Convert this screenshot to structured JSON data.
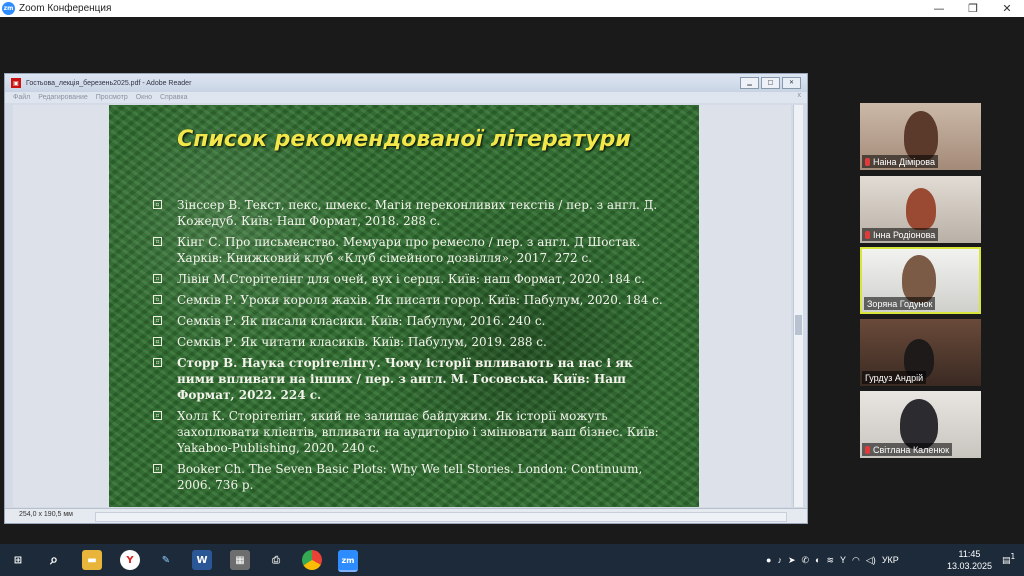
{
  "zoom": {
    "app_title": "Zoom Конференция",
    "logo_text": "zm",
    "controls": {
      "minimize": "—",
      "maximize": "❐",
      "close": "✕"
    }
  },
  "reader": {
    "window_title": "Гостьова_лекція_березень2025.pdf - Adobe Reader",
    "menu": [
      "Файл",
      "Редагирование",
      "Просмотр",
      "Окно",
      "Справка"
    ],
    "menu_close": "x",
    "page_size": "254,0 x 190,5 мм",
    "scroll_position": 0.55
  },
  "slide": {
    "title": "Список рекомендованої літератури",
    "bullet_glyph": "▫",
    "items": [
      {
        "text": "Зінссер В. Текст, пекс, шмекс. Магія переконливих текстів / пер. з англ. Д. Кожедуб. Київ: Наш Формат, 2018. 288 с.",
        "bold": false
      },
      {
        "text": "Кінг С. Про письменство. Мемуари про ремесло / пер. з англ. Д Шостак. Харків: Книжковий клуб «Клуб сімейного дозвілля», 2017. 272 с.",
        "bold": false
      },
      {
        "text": "Лівін М.Сторітелінг для очей, вух і серця. Київ: наш Формат, 2020. 184 с.",
        "bold": false
      },
      {
        "text": "Семків Р. Уроки короля жахів. Як писати горор. Київ: Пабулум, 2020. 184 с.",
        "bold": false
      },
      {
        "text": "Семків Р. Як писали класики. Київ: Пабулум, 2016. 240 с.",
        "bold": false
      },
      {
        "text": "Семків Р. Як читати класиків. Київ: Пабулум, 2019. 288 с.",
        "bold": false
      },
      {
        "text": "Сторр В. Наука сторітелінгу. Чому історії впливають на нас і як ними впливати на інших / пер. з англ. М. Госовська. Київ: Наш Формат, 2022. 224 с.",
        "bold": true
      },
      {
        "text": "Холл К. Сторітелінг, який не залишає байдужим. Як історії можуть захоплювати клієнтів, впливати на аудиторію і змінювати ваш бізнес. Київ: Yakaboo-Publishing, 2020. 240 с.",
        "bold": false
      },
      {
        "text": "Booker Ch. The Seven Basic Plots: Why We tell Stories. London: Continuum, 2006. 736 p.",
        "bold": false
      }
    ]
  },
  "participants": [
    {
      "name": "Наіна Дімірова",
      "muted": true,
      "active": false
    },
    {
      "name": "Інна Родіонова",
      "muted": true,
      "active": false
    },
    {
      "name": "Зоряна Годунок",
      "muted": false,
      "active": true
    },
    {
      "name": "Гурдуз Андрій",
      "muted": false,
      "active": false
    },
    {
      "name": "Світлана Каленюк",
      "muted": true,
      "active": false
    }
  ],
  "taskbar": {
    "language": "УКР",
    "time": "11:45",
    "date": "13.03.2025",
    "notification_count": "1",
    "zoom_label": "zm",
    "word_label": "W"
  },
  "colors": {
    "slide_title": "#f3e84a",
    "slide_text": "#f4f4ec",
    "slide_bg": "#2f6e2f",
    "active_speaker": "#d8e63a",
    "zoom_blue": "#2d8cff"
  }
}
